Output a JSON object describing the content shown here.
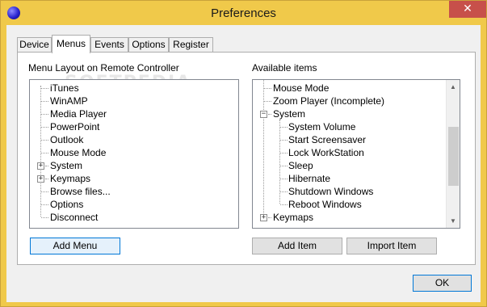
{
  "window": {
    "title": "Preferences",
    "close_glyph": "✕"
  },
  "tabs": [
    {
      "label": "Device",
      "active": false
    },
    {
      "label": "Menus",
      "active": true
    },
    {
      "label": "Events",
      "active": false
    },
    {
      "label": "Options",
      "active": false
    },
    {
      "label": "Register",
      "active": false
    }
  ],
  "left_panel": {
    "label": "Menu Layout on Remote Controller",
    "items": [
      {
        "label": "iTunes",
        "expandable": false
      },
      {
        "label": "WinAMP",
        "expandable": false
      },
      {
        "label": "Media Player",
        "expandable": false
      },
      {
        "label": "PowerPoint",
        "expandable": false
      },
      {
        "label": "Outlook",
        "expandable": false
      },
      {
        "label": "Mouse Mode",
        "expandable": false
      },
      {
        "label": "System",
        "expandable": true,
        "expander": "+"
      },
      {
        "label": "Keymaps",
        "expandable": true,
        "expander": "+"
      },
      {
        "label": "Browse files...",
        "expandable": false
      },
      {
        "label": "Options",
        "expandable": false
      },
      {
        "label": "Disconnect",
        "expandable": false
      }
    ],
    "button": "Add Menu"
  },
  "right_panel": {
    "label": "Available items",
    "items": [
      {
        "label": "Mouse Mode",
        "level": 0
      },
      {
        "label": "Zoom Player (Incomplete)",
        "level": 0
      },
      {
        "label": "System",
        "level": 0,
        "expander": "−"
      },
      {
        "label": "System Volume",
        "level": 1
      },
      {
        "label": "Start Screensaver",
        "level": 1
      },
      {
        "label": "Lock WorkStation",
        "level": 1
      },
      {
        "label": "Sleep",
        "level": 1
      },
      {
        "label": "Hibernate",
        "level": 1
      },
      {
        "label": "Shutdown Windows",
        "level": 1
      },
      {
        "label": "Reboot Windows",
        "level": 1
      },
      {
        "label": "Keymaps",
        "level": 0,
        "expander": "+"
      }
    ],
    "scroll_up": "▲",
    "scroll_down": "▼",
    "buttons": {
      "add": "Add Item",
      "import": "Import Item"
    }
  },
  "footer": {
    "ok": "OK"
  },
  "colors": {
    "title_bar": "#f0c94a",
    "close_button": "#c7504a",
    "focus_border": "#0078d7"
  }
}
